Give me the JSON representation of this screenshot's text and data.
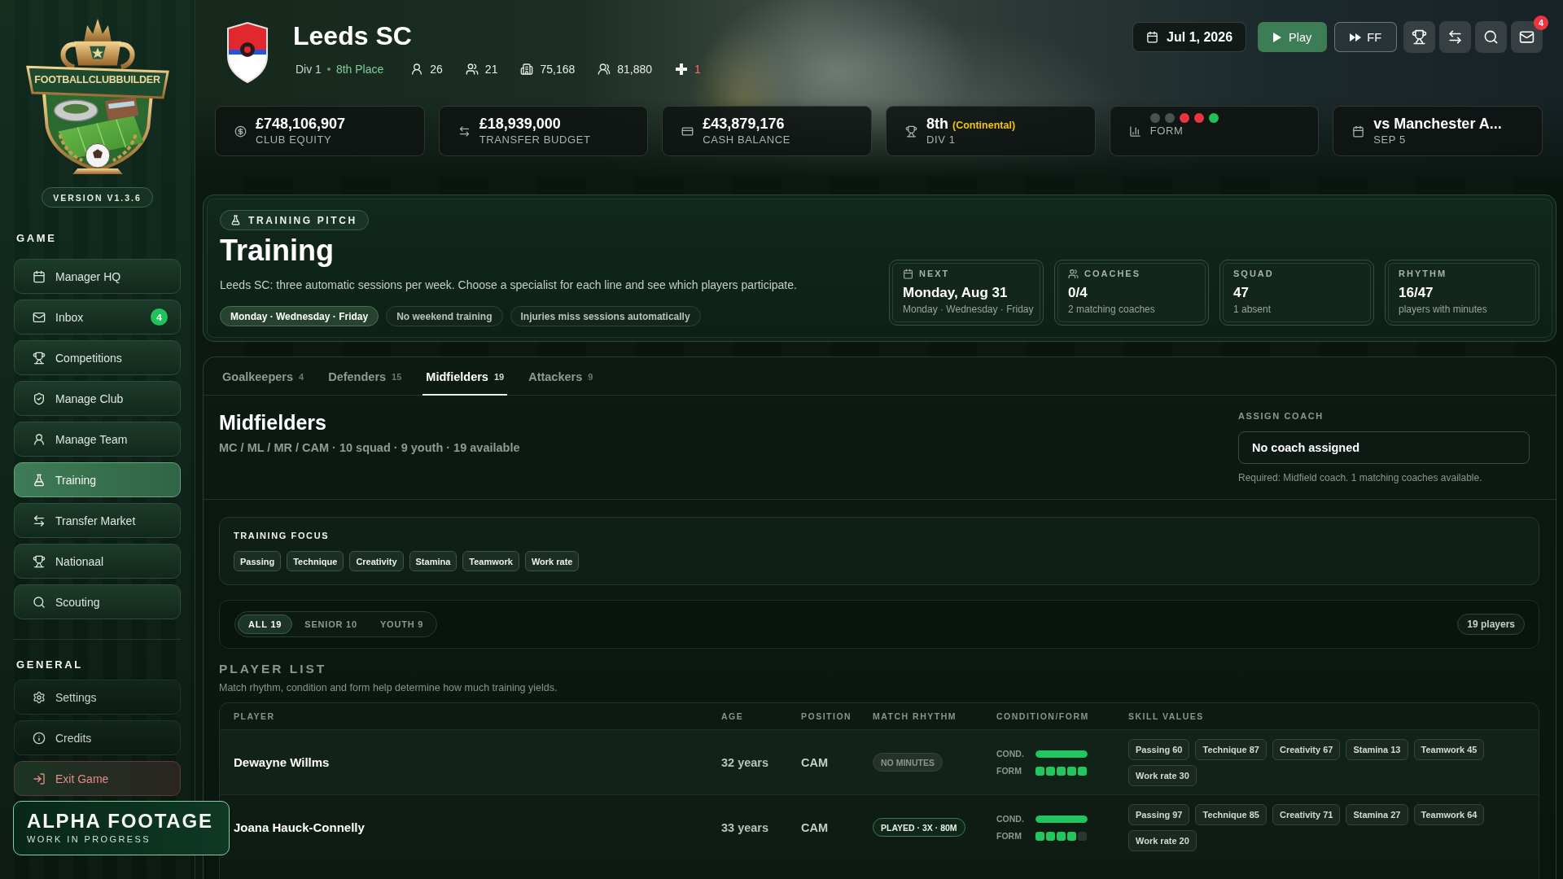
{
  "sidebar": {
    "logo_text": "FOOTBALLCLUBBUILDER",
    "version": "VERSION V1.3.6",
    "sections": [
      {
        "title": "GAME",
        "items": [
          {
            "label": "Manager HQ",
            "selected": false
          },
          {
            "label": "Inbox",
            "badge": "4",
            "selected": false
          },
          {
            "label": "Competitions",
            "selected": false
          },
          {
            "label": "Manage Club",
            "selected": false
          },
          {
            "label": "Manage Team",
            "selected": false
          },
          {
            "label": "Training",
            "selected": true
          },
          {
            "label": "Transfer Market",
            "selected": false
          },
          {
            "label": "Nationaal",
            "selected": false
          },
          {
            "label": "Scouting",
            "selected": false
          }
        ]
      },
      {
        "title": "GENERAL",
        "items": [
          {
            "label": "Settings",
            "kind": "plain",
            "selected": false
          },
          {
            "label": "Credits",
            "kind": "plain",
            "selected": false
          },
          {
            "label": "Exit Game",
            "kind": "danger",
            "selected": false
          }
        ]
      }
    ]
  },
  "club": {
    "name": "Leeds SC",
    "division": "Div 1",
    "place": "8th Place",
    "stats": [
      {
        "kind": "count",
        "value": "26"
      },
      {
        "kind": "count",
        "value": "21"
      },
      {
        "kind": "count",
        "value": "75,168"
      },
      {
        "kind": "count",
        "value": "81,880"
      },
      {
        "kind": "injuries",
        "value": "1"
      }
    ]
  },
  "toolbar": {
    "date": "Jul 1, 2026",
    "play": "Play",
    "fast_forward": "FF",
    "mail_badge": "4"
  },
  "stat_cards": [
    {
      "kind": "value",
      "value": "£748,106,907",
      "label": "CLUB EQUITY"
    },
    {
      "kind": "value",
      "value": "£18,939,000",
      "label": "TRANSFER BUDGET"
    },
    {
      "kind": "value",
      "value": "£43,879,176",
      "label": "CASH BALANCE"
    },
    {
      "kind": "value",
      "value": "8th",
      "note": "(Continental)",
      "label": "DIV 1"
    },
    {
      "kind": "form",
      "label": "FORM",
      "results": [
        {
          "color": "#4b524e"
        },
        {
          "color": "#4b524e"
        },
        {
          "color": "#ef3340"
        },
        {
          "color": "#ef3340"
        },
        {
          "color": "#1fc15a"
        }
      ]
    },
    {
      "kind": "value",
      "value": "vs Manchester A...",
      "label": "SEP 5"
    }
  ],
  "training": {
    "badge": "TRAINING PITCH",
    "title": "Training",
    "description": "Leeds SC: three automatic sessions per week. Choose a specialist for each line and see which players participate.",
    "chips": [
      {
        "label": "Monday · Wednesday · Friday",
        "highlighted": true
      },
      {
        "label": "No weekend training",
        "highlighted": false
      },
      {
        "label": "Injuries miss sessions automatically",
        "highlighted": false
      }
    ],
    "info_cards": [
      {
        "label": "NEXT",
        "value": "Monday, Aug 31",
        "sub": "Monday · Wednesday · Friday"
      },
      {
        "label": "COACHES",
        "value": "0/4",
        "sub": "2 matching coaches"
      },
      {
        "label": "SQUAD",
        "value": "47",
        "sub": "1 absent"
      },
      {
        "label": "RHYTHM",
        "value": "16/47",
        "sub": "players with minutes"
      }
    ]
  },
  "tabs": [
    {
      "label": "Goalkeepers",
      "count": "4",
      "selected": false
    },
    {
      "label": "Defenders",
      "count": "15",
      "selected": false
    },
    {
      "label": "Midfielders",
      "count": "19",
      "selected": true
    },
    {
      "label": "Attackers",
      "count": "9",
      "selected": false
    }
  ],
  "group": {
    "title": "Midfielders",
    "subtitle": "MC / ML / MR / CAM · 10 squad · 9 youth · 19 available",
    "coach_label": "ASSIGN COACH",
    "coach_value": "No coach assigned",
    "coach_note": "Required: Midfield coach. 1 matching coaches available."
  },
  "focus": {
    "label": "TRAINING FOCUS",
    "chips": [
      "Passing",
      "Technique",
      "Creativity",
      "Stamina",
      "Teamwork",
      "Work rate"
    ]
  },
  "filter": {
    "segments": [
      {
        "label": "ALL 19",
        "selected": true
      },
      {
        "label": "SENIOR 10",
        "selected": false
      },
      {
        "label": "YOUTH 9",
        "selected": false
      }
    ],
    "count": "19 players"
  },
  "player_list": {
    "title": "PLAYER LIST",
    "subtitle": "Match rhythm, condition and form help determine how much training yields.",
    "columns": [
      "PLAYER",
      "AGE",
      "POSITION",
      "MATCH RHYTHM",
      "CONDITION/FORM",
      "SKILL VALUES"
    ],
    "rows": [
      {
        "name": "Dewayne Willms",
        "age": "32 years",
        "position": "CAM",
        "rhythm": {
          "kind": "none",
          "text": "NO MINUTES"
        },
        "condition": {
          "label": "COND.",
          "level": 1
        },
        "form": {
          "label": "FORM",
          "stars": 5
        },
        "skills": [
          "Passing 60",
          "Technique 87",
          "Creativity 67",
          "Stamina 13",
          "Teamwork 45",
          "Work rate 30"
        ]
      },
      {
        "name": "Joana Hauck-Connelly",
        "age": "33 years",
        "position": "CAM",
        "rhythm": {
          "kind": "played",
          "text": "PLAYED · 3X · 80M"
        },
        "condition": {
          "label": "COND.",
          "level": 1
        },
        "form": {
          "label": "FORM",
          "stars": 4
        },
        "skills": [
          "Passing 97",
          "Technique 85",
          "Creativity 71",
          "Stamina 27",
          "Teamwork 64",
          "Work rate 20"
        ]
      }
    ]
  },
  "overlay": {
    "title": "ALPHA FOOTAGE",
    "subtitle": "WORK IN PROGRESS"
  }
}
